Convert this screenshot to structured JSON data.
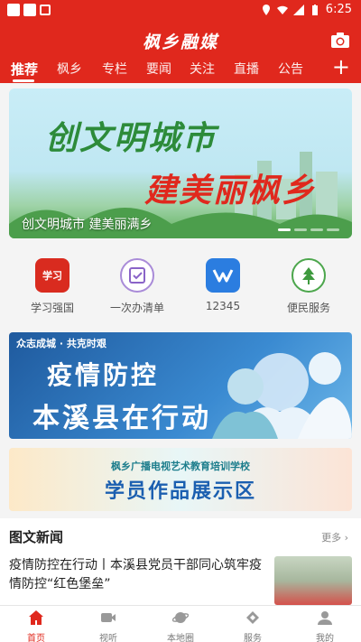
{
  "status_bar": {
    "time": "6:25"
  },
  "header": {
    "title": "枫乡融媒"
  },
  "tabs": [
    {
      "label": "推荐",
      "active": true
    },
    {
      "label": "枫乡"
    },
    {
      "label": "专栏"
    },
    {
      "label": "要闻"
    },
    {
      "label": "关注"
    },
    {
      "label": "直播"
    },
    {
      "label": "公告"
    }
  ],
  "carousel": {
    "headline_line1": "创文明城市",
    "headline_line2": "建美丽枫乡",
    "caption": "创文明城市 建美丽满乡"
  },
  "quick_entries": [
    {
      "label": "学习强国",
      "icon": "xuexi-qiangguo-icon"
    },
    {
      "label": "一次办清单",
      "icon": "checklist-icon"
    },
    {
      "label": "12345",
      "icon": "hotline-icon"
    },
    {
      "label": "便民服务",
      "icon": "tree-service-icon"
    }
  ],
  "banner_epidemic": {
    "tag": "众志成城 · 共克时艰",
    "line1": "疫情防控",
    "line2": "本溪县在行动"
  },
  "banner_school": {
    "subtitle": "枫乡广播电视艺术教育培训学校",
    "title": "学员作品展示区"
  },
  "news": {
    "section_title": "图文新闻",
    "more_label": "更多",
    "item_text": "疫情防控在行动丨本溪县党员干部同心筑牢疫情防控“红色堡垒”"
  },
  "bottom_nav": [
    {
      "label": "首页",
      "icon": "home-icon",
      "active": true
    },
    {
      "label": "视听",
      "icon": "video-icon"
    },
    {
      "label": "本地圈",
      "icon": "planet-icon"
    },
    {
      "label": "服务",
      "icon": "service-icon"
    },
    {
      "label": "我的",
      "icon": "user-icon"
    }
  ],
  "colors": {
    "brand_red": "#e0281d",
    "active_nav": "#e0281d"
  }
}
